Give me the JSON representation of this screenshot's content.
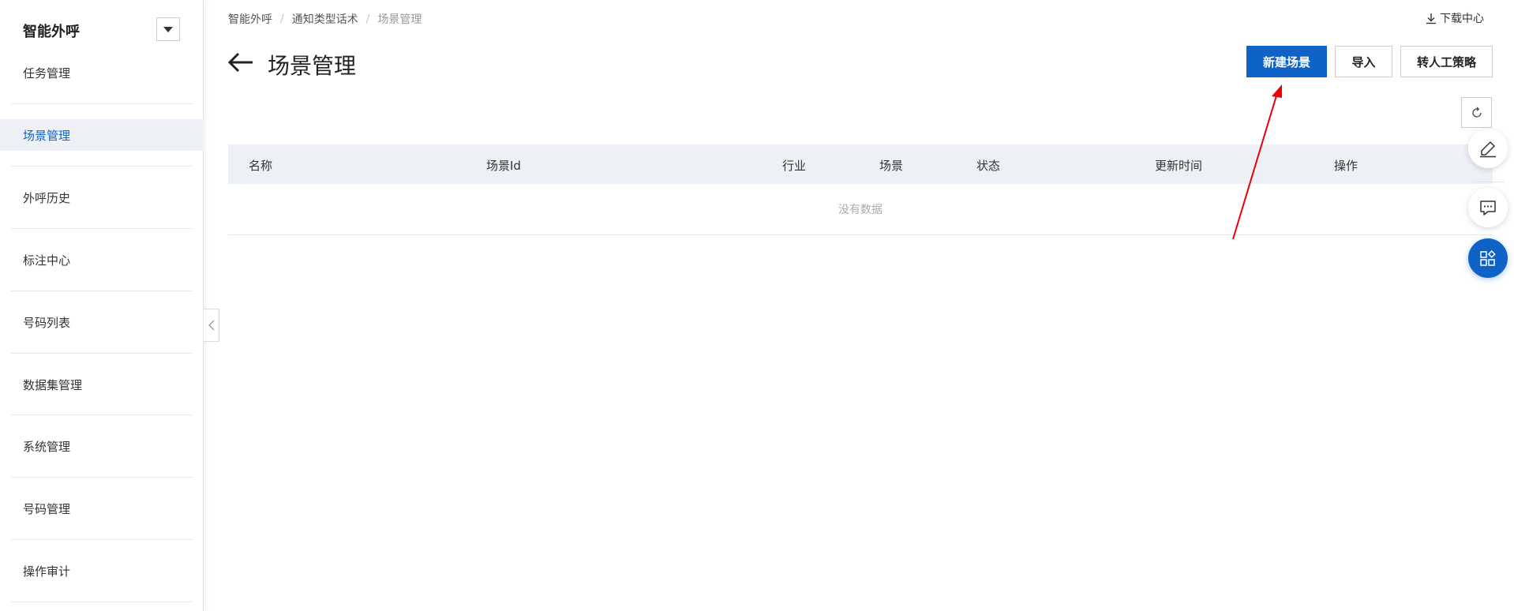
{
  "sidebar": {
    "title": "智能外呼",
    "items": [
      {
        "label": "任务管理",
        "active": false
      },
      {
        "label": "场景管理",
        "active": true
      },
      {
        "label": "外呼历史",
        "active": false
      },
      {
        "label": "标注中心",
        "active": false
      },
      {
        "label": "号码列表",
        "active": false
      },
      {
        "label": "数据集管理",
        "active": false
      },
      {
        "label": "系统管理",
        "active": false
      },
      {
        "label": "号码管理",
        "active": false
      },
      {
        "label": "操作审计",
        "active": false
      }
    ]
  },
  "breadcrumb": {
    "items": [
      "智能外呼",
      "通知类型话术",
      "场景管理"
    ],
    "separator": "/"
  },
  "header": {
    "download_center": "下载中心",
    "page_title": "场景管理"
  },
  "actions": {
    "new_scene": "新建场景",
    "import": "导入",
    "transfer_strategy": "转人工策略"
  },
  "table": {
    "columns": [
      "名称",
      "场景Id",
      "行业",
      "场景",
      "状态",
      "更新时间",
      "操作"
    ],
    "empty_text": "没有数据"
  },
  "colors": {
    "primary": "#1063c6",
    "header_bg": "#edf0f5",
    "annotation": "#e8000b"
  },
  "icons": [
    "chevron-down-icon",
    "chevron-left-icon",
    "download-icon",
    "back-arrow-icon",
    "refresh-icon",
    "pencil-icon",
    "chat-icon",
    "apps-icon"
  ]
}
